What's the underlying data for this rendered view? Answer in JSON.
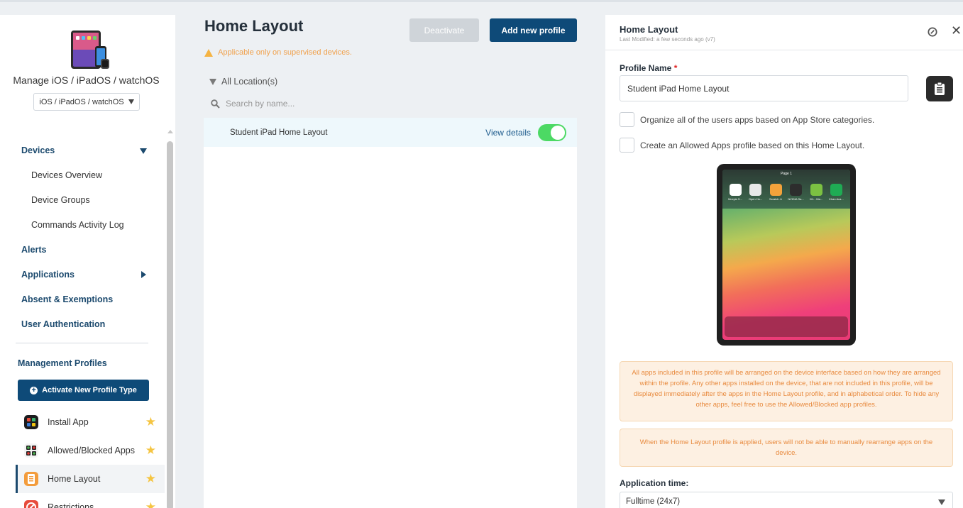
{
  "sidebar": {
    "manage_title": "Manage iOS / iPadOS / watchOS",
    "os_select_value": "iOS / iPadOS / watchOS",
    "nav": {
      "devices": "Devices",
      "devices_overview": "Devices Overview",
      "device_groups": "Device Groups",
      "commands_log": "Commands Activity Log",
      "alerts": "Alerts",
      "applications": "Applications",
      "absent": "Absent & Exemptions",
      "user_auth": "User Authentication"
    },
    "management_profiles_title": "Management Profiles",
    "activate_button": "Activate New Profile Type",
    "profiles": [
      {
        "label": "Install App"
      },
      {
        "label": "Allowed/Blocked Apps"
      },
      {
        "label": "Home Layout"
      },
      {
        "label": "Restrictions"
      }
    ]
  },
  "main": {
    "title": "Home Layout",
    "warning": "Applicable only on supervised devices.",
    "deactivate_label": "Deactivate",
    "add_profile_label": "Add new profile",
    "filter_label": "All Location(s)",
    "search_placeholder": "Search by name...",
    "list": [
      {
        "name": "Student iPad Home Layout",
        "action": "View details",
        "enabled": true
      }
    ]
  },
  "detail": {
    "title": "Home Layout",
    "subtitle": "Last Modified: a few seconds ago (v7)",
    "profile_name_label": "Profile Name",
    "required_mark": "*",
    "profile_name_value": "Student iPad Home Layout",
    "checkbox_organize": "Organize all of the users apps based on App Store categories.",
    "checkbox_allowed": "Create an Allowed Apps profile based on this Home Layout.",
    "preview": {
      "page_label": "Page 1",
      "apps": [
        {
          "label": "Moxyla S...",
          "color": "#ffffff"
        },
        {
          "label": "Open Ho...",
          "color": "#e8e8e8"
        },
        {
          "label": "Scratch Jr",
          "color": "#f3a23b"
        },
        {
          "label": "NVIDIA Sa...",
          "color": "#2d2d2d"
        },
        {
          "label": "IXL - Ma...",
          "color": "#7cc142"
        },
        {
          "label": "Khan Aca...",
          "color": "#1fab54"
        }
      ]
    },
    "info_text": "All apps included in this profile will be arranged on the device interface based on how they are arranged within the profile. Any other apps installed on the device, that are not included in this profile, will be displayed immediately after the apps in the Home Layout profile, and in alphabetical order. To hide any other apps, feel free to use the Allowed/Blocked app profiles.",
    "warning_text": "When the Home Layout profile is applied, users will not be able to manually rearrange apps on the device.",
    "application_time_label": "Application time:",
    "application_time_value": "Fulltime (24x7)"
  }
}
